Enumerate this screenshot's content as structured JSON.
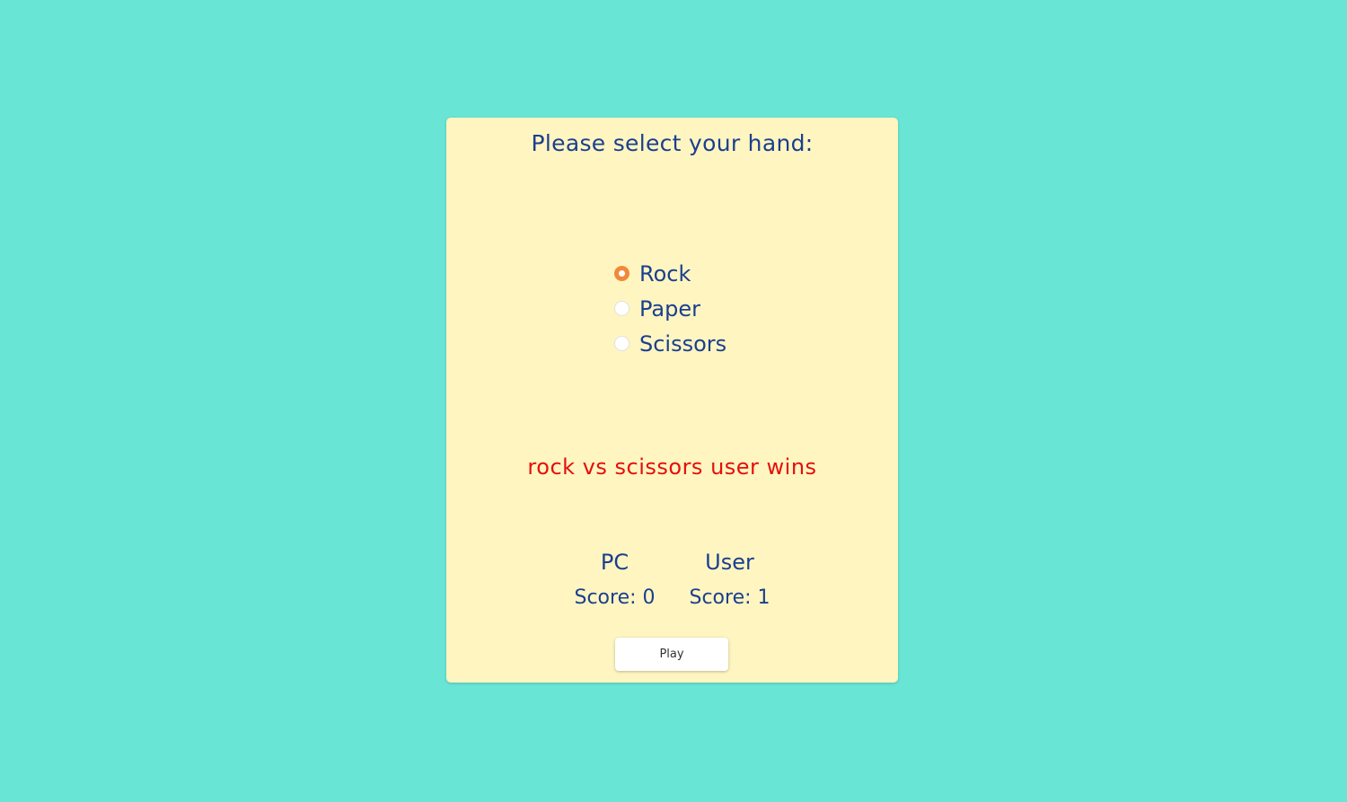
{
  "colors": {
    "background": "#69e5d5",
    "card": "#fef5c0",
    "text": "#1b3f8f",
    "result": "#e60e0e",
    "radio_selected": "#f08a3a"
  },
  "title": "Please select your hand:",
  "hands": [
    {
      "label": "Rock",
      "selected": true
    },
    {
      "label": "Paper",
      "selected": false
    },
    {
      "label": "Scissors",
      "selected": false
    }
  ],
  "result": "rock vs scissors user wins",
  "scoreboard": {
    "pc": {
      "name": "PC",
      "score_text": "Score: 0"
    },
    "user": {
      "name": "User",
      "score_text": "Score: 1"
    }
  },
  "play_button": "Play"
}
